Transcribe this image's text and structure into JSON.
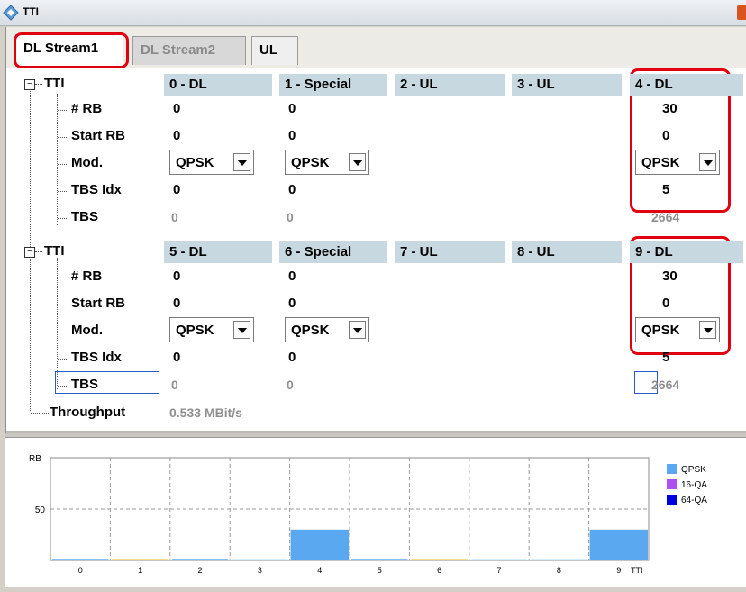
{
  "window": {
    "title": "TTI"
  },
  "tabs": [
    {
      "label": "DL Stream1",
      "active": true
    },
    {
      "label": "DL Stream2",
      "active": false
    },
    {
      "label": "UL",
      "active": false
    }
  ],
  "tree": {
    "row_labels": [
      "# RB",
      "Start RB",
      "Mod.",
      "TBS Idx",
      "TBS"
    ],
    "groups": [
      {
        "label": "TTI",
        "columns": [
          {
            "header": "0 - DL",
            "rb": "0",
            "start_rb": "0",
            "mod": "QPSK",
            "tbs_idx": "0",
            "tbs": "0"
          },
          {
            "header": "1 - Special",
            "rb": "0",
            "start_rb": "0",
            "mod": "QPSK",
            "tbs_idx": "0",
            "tbs": "0"
          },
          {
            "header": "2 - UL"
          },
          {
            "header": "3 - UL"
          },
          {
            "header": "4 - DL",
            "rb": "30",
            "start_rb": "0",
            "mod": "QPSK",
            "tbs_idx": "5",
            "tbs": "2664"
          }
        ]
      },
      {
        "label": "TTI",
        "columns": [
          {
            "header": "5 - DL",
            "rb": "0",
            "start_rb": "0",
            "mod": "QPSK",
            "tbs_idx": "0",
            "tbs": "0"
          },
          {
            "header": "6 - Special",
            "rb": "0",
            "start_rb": "0",
            "mod": "QPSK",
            "tbs_idx": "0",
            "tbs": "0"
          },
          {
            "header": "7 - UL"
          },
          {
            "header": "8 - UL"
          },
          {
            "header": "9 - DL",
            "rb": "30",
            "start_rb": "0",
            "mod": "QPSK",
            "tbs_idx": "5",
            "tbs": "2664"
          }
        ]
      }
    ],
    "throughput_label": "Throughput",
    "throughput_value": "0.533 MBit/s"
  },
  "colors": {
    "highlight_ring": "#e00010",
    "header_bg": "#c8d8e0",
    "qpsk": "#5aa8f0",
    "qam16": "#b050f0",
    "qam64": "#0000e0"
  },
  "chart_data": {
    "type": "bar",
    "ylabel": "RB",
    "ytick_labels": [
      "50"
    ],
    "ylim": [
      0,
      100
    ],
    "xlabel": "TTI",
    "categories": [
      "0",
      "1",
      "2",
      "3",
      "4",
      "5",
      "6",
      "7",
      "8",
      "9"
    ],
    "series": [
      {
        "name": "QPSK",
        "color": "#5aa8f0",
        "values": [
          0,
          0,
          0,
          0,
          30,
          0,
          0,
          0,
          0,
          30
        ]
      },
      {
        "name": "16-QA",
        "color": "#b050f0",
        "values": [
          0,
          0,
          0,
          0,
          0,
          0,
          0,
          0,
          0,
          0
        ]
      },
      {
        "name": "64-QA",
        "color": "#0000e0",
        "values": [
          0,
          0,
          0,
          0,
          0,
          0,
          0,
          0,
          0,
          0
        ]
      }
    ],
    "legend_position": "right",
    "grid": true
  }
}
